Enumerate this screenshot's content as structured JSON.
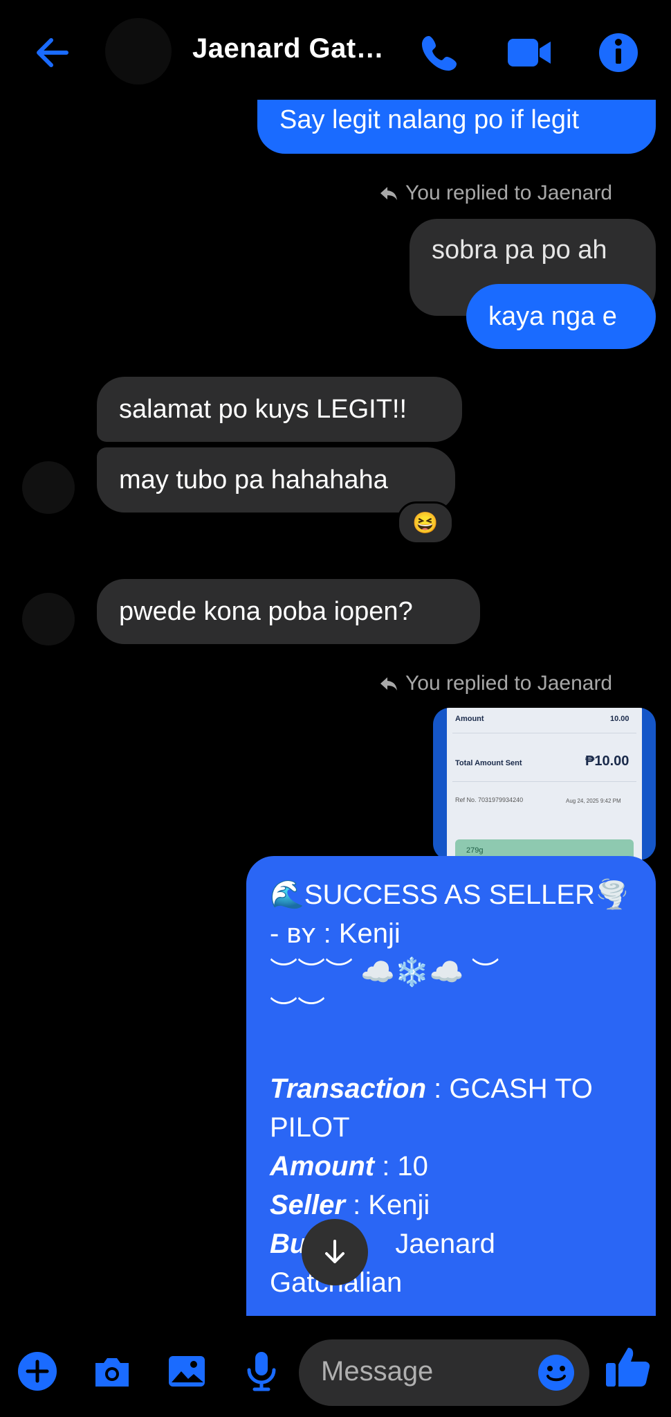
{
  "header": {
    "title": "Jaenard Gat…",
    "icons": [
      "back-arrow-icon",
      "phone-icon",
      "video-icon",
      "info-icon"
    ]
  },
  "messages": {
    "m1": "Say legit nalang po if legit",
    "reply_label_1": "You replied to Jaenard",
    "quoted_1": "sobra pa po ah",
    "m2": "kaya nga e",
    "in1": "salamat po kuys LEGIT!!",
    "in2": "may tubo pa hahahaha",
    "reaction": "😆",
    "in3": "pwede kona poba iopen?",
    "reply_label_2": "You replied to Jaenard"
  },
  "receipt_preview": {
    "amount_label": "Amount",
    "amount_value": "10.00",
    "total_label": "Total Amount Sent",
    "total_value": "₱10.00",
    "ref": "Ref No. 7031979934240",
    "date": "Aug 24, 2025 9:42 PM",
    "bottom": "279g"
  },
  "big_message": {
    "line1": "🌊SUCCESS AS SELLER🌪️",
    "line2": "- ʙʏ : Kenji",
    "line3": "︶︶︶ ☁️❄️☁️ ︶",
    "line4": "︶︶",
    "transaction_key": "Transaction",
    "transaction_val": " : GCASH TO",
    "transaction_val2": "PILOT",
    "amount_key": "Amount",
    "amount_val": " : 10",
    "seller_key": "Seller",
    "seller_val": " : Kenji",
    "buyer_key": "Bu",
    "buyer_val": "Jaenard",
    "buyer_val2": "Gatchalian"
  },
  "composer": {
    "placeholder": "Message",
    "icons": [
      "plus-icon",
      "camera-icon",
      "gallery-icon",
      "mic-icon",
      "emoji-icon",
      "thumbs-up-icon"
    ]
  },
  "colors": {
    "accent": "#1a6bff",
    "outgoing_bubble": "#1a6bff",
    "incoming_bubble": "#2d2d2e",
    "background": "#000000"
  }
}
